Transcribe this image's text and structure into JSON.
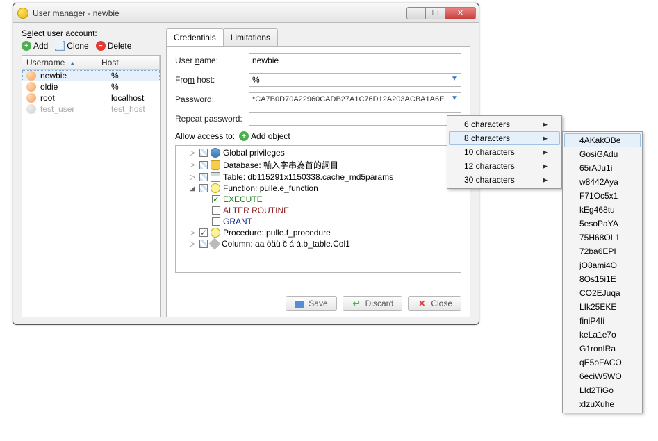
{
  "window": {
    "title": "User manager - newbie"
  },
  "left": {
    "label_pre": "S",
    "label_ul": "e",
    "label_post": "lect user account:",
    "add": "Add",
    "clone": "Clone",
    "delete": "Delete",
    "col_user_pre": "",
    "col_user_ul": "U",
    "col_user_post": "sername",
    "col_host": "Host",
    "users": [
      {
        "name": "newbie",
        "host": "%",
        "selected": true,
        "enabled": true
      },
      {
        "name": "oldie",
        "host": "%",
        "selected": false,
        "enabled": true
      },
      {
        "name": "root",
        "host": "localhost",
        "selected": false,
        "enabled": true
      },
      {
        "name": "test_user",
        "host": "test_host",
        "selected": false,
        "enabled": false
      }
    ]
  },
  "tabs": {
    "credentials": "Credentials",
    "limitations": "Limitations"
  },
  "form": {
    "username_pre": "User ",
    "username_ul": "n",
    "username_post": "ame:",
    "username_val": "newbie",
    "host_pre": "Fro",
    "host_ul": "m",
    "host_post": " host:",
    "host_val": "%",
    "pass_pre": "",
    "pass_ul": "P",
    "pass_post": "assword:",
    "pass_val": "*CA7B0D70A22960CADB27A1C76D12A203ACBA1A6E",
    "rpass": "Repeat password:",
    "rpass_val": ""
  },
  "access": {
    "label": "Allow access to:",
    "add": "Add object"
  },
  "tree": {
    "global": "Global privileges",
    "database": "Database: 輸入字串為首的詞目",
    "table": "Table: db115291x1150338.cache_md5params",
    "function": "Function: pulle.e_function",
    "execute": "EXECUTE",
    "alter": "ALTER ROUTINE",
    "grant": "GRANT",
    "procedure": "Procedure: pulle.f_procedure",
    "column": "Column: aa öäü č á á.b_table.Col1"
  },
  "buttons": {
    "save": "Save",
    "discard": "Discard",
    "close": "Close"
  },
  "menu1": {
    "items": [
      {
        "label": "6 characters"
      },
      {
        "label": "8 characters",
        "hover": true
      },
      {
        "label": "10 characters"
      },
      {
        "label": "12 characters"
      },
      {
        "label": "30 characters"
      }
    ]
  },
  "menu2": {
    "items": [
      {
        "label": "4AKakOBe",
        "hover": true
      },
      {
        "label": "GosiGAdu"
      },
      {
        "label": "65rAJu1i"
      },
      {
        "label": "w8442Aya"
      },
      {
        "label": "F71Oc5x1"
      },
      {
        "label": "kEg468tu"
      },
      {
        "label": "5esoPaYA"
      },
      {
        "label": "75H68OL1"
      },
      {
        "label": "72ba6EPI"
      },
      {
        "label": "jO8ami4O"
      },
      {
        "label": "8Os15i1E"
      },
      {
        "label": "CO2EJuqa"
      },
      {
        "label": "LIk25EKE"
      },
      {
        "label": "finiP4Ii"
      },
      {
        "label": "keLa1e7o"
      },
      {
        "label": "G1ronIRa"
      },
      {
        "label": "qE5oFACO"
      },
      {
        "label": "6eciW5WO"
      },
      {
        "label": "LId2TiGo"
      },
      {
        "label": "xIzuXuhe"
      }
    ]
  }
}
